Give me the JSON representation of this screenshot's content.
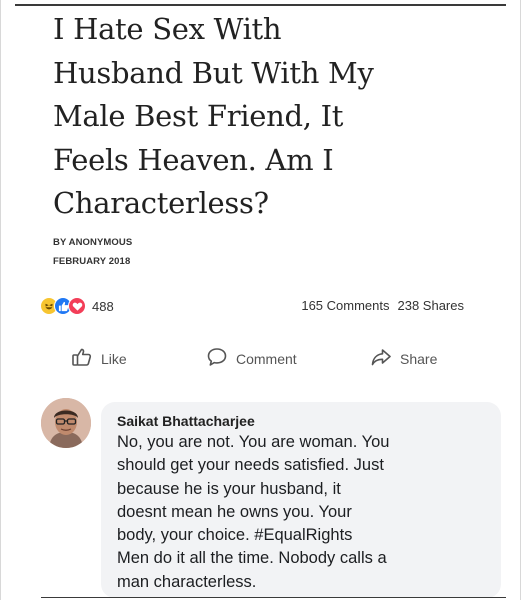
{
  "article": {
    "headline_lines": [
      "I Hate Sex With",
      "Husband But With My",
      "Male Best Friend, It",
      "Feels Heaven. Am I",
      "Characterless?"
    ],
    "author": "BY ANONYMOUS",
    "date": "FEBRUARY 2018"
  },
  "engagement": {
    "reaction_count": "488",
    "comments": "165 Comments",
    "shares": "238 Shares",
    "reaction_icons": [
      "haha-icon",
      "like-icon",
      "love-icon"
    ]
  },
  "actions": {
    "like": "Like",
    "comment": "Comment",
    "share": "Share"
  },
  "comment": {
    "name": "Saikat Bhattacharjee",
    "lines": [
      "No, you are not. You are woman. You",
      "should get your needs satisfied. Just",
      "because he is your husband, it",
      "doesnt mean he owns you. Your",
      "body, your choice. #EqualRights",
      "Men do it all the time. Nobody calls a",
      "man characterless."
    ]
  },
  "colors": {
    "like_blue": "#2078f4",
    "love_red": "#f33e58",
    "haha_yellow": "#f7c530",
    "bubble_bg": "#f2f3f5"
  }
}
